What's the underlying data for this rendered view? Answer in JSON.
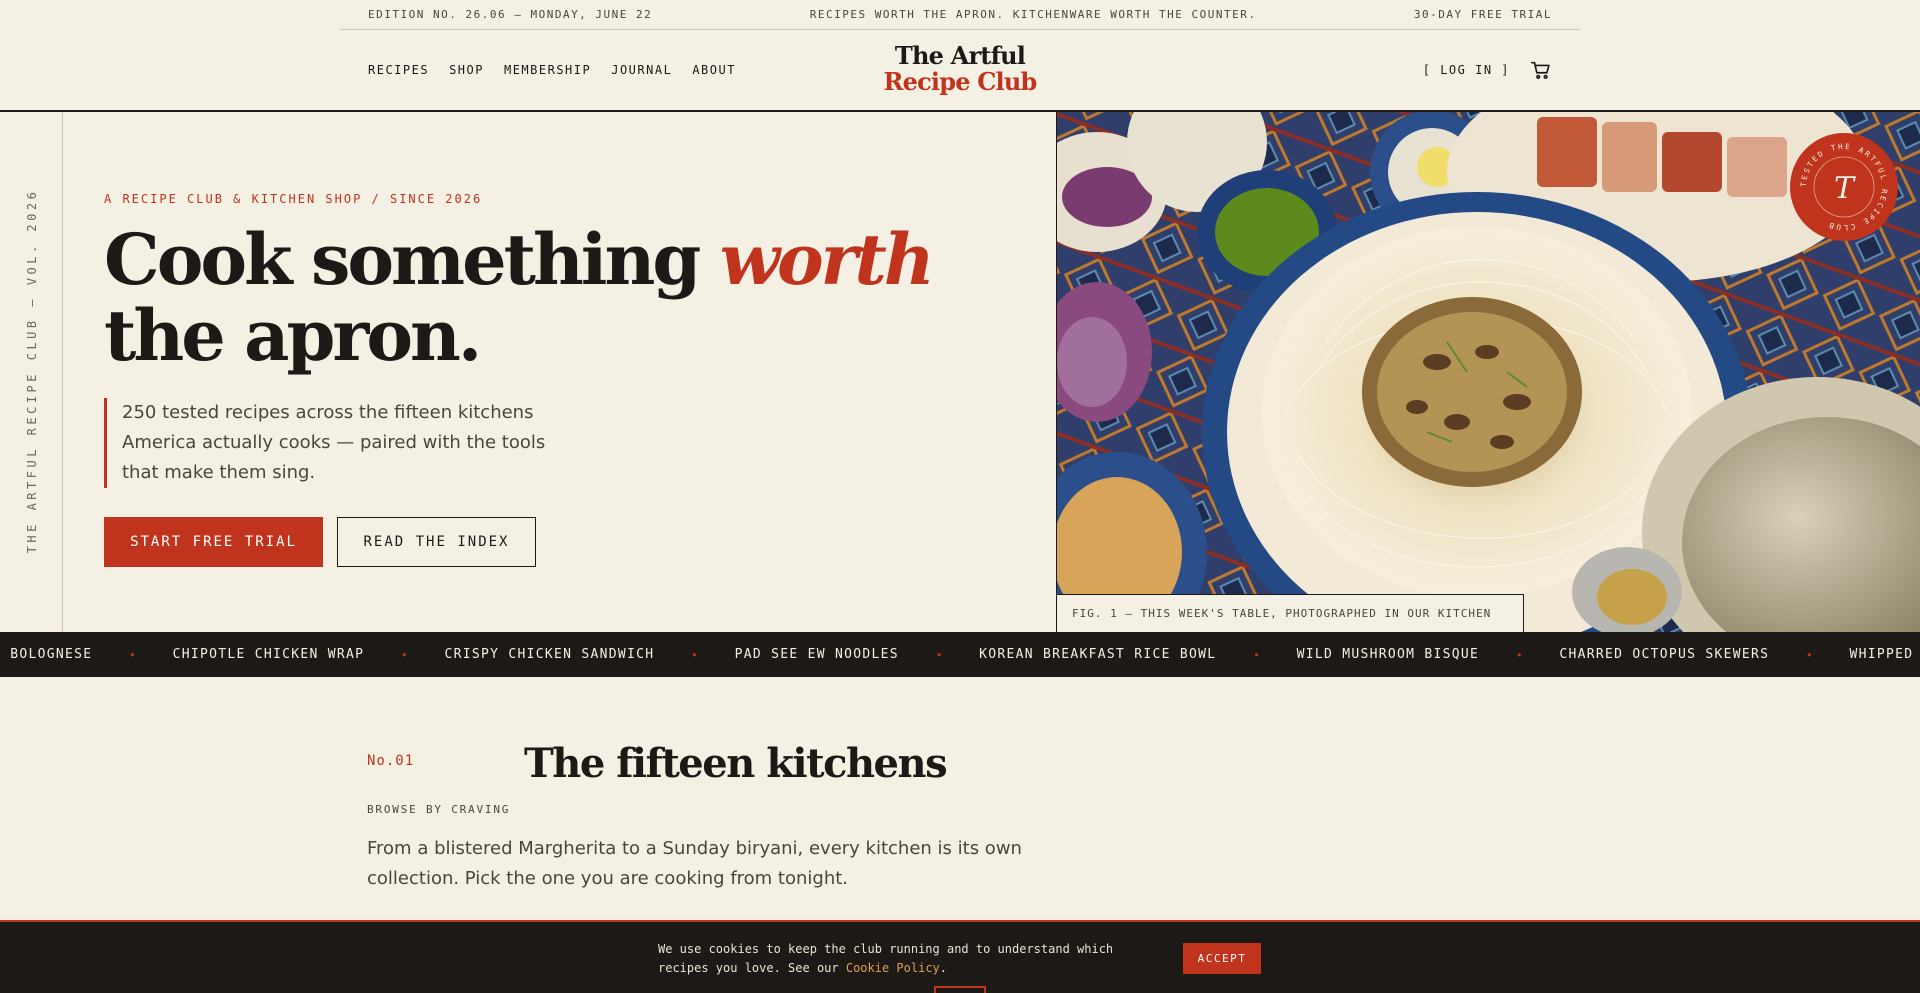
{
  "topbar": {
    "edition": "EDITION NO. 26.06 — MONDAY, JUNE 22",
    "tagline": "RECIPES WORTH THE APRON. KITCHENWARE WORTH THE COUNTER.",
    "trial": "30-DAY FREE TRIAL"
  },
  "nav": {
    "links": [
      "RECIPES",
      "SHOP",
      "MEMBERSHIP",
      "JOURNAL",
      "ABOUT"
    ],
    "logo_line1": "The Artful",
    "logo_line2": "Recipe Club",
    "login": "[ LOG IN ]",
    "cart_icon": "cart-icon"
  },
  "hero": {
    "vertical_label": "THE ARTFUL RECIPE CLUB — VOL. 2026",
    "eyebrow": "A RECIPE CLUB & KITCHEN SHOP / SINCE 2026",
    "title_pre": "Cook something ",
    "title_em": "worth",
    "title_post": " the apron.",
    "description": "250 tested recipes across the fifteen kitchens America actually cooks — paired with the tools that make them sing.",
    "cta_primary": "START FREE TRIAL",
    "cta_secondary": "READ THE INDEX",
    "image_caption": "FIG. 1 — THIS WEEK'S TABLE, PHOTOGRAPHED IN OUR KITCHEN",
    "seal_ring_text": "TESTED THE ARTFUL RECIPE CLUB",
    "seal_letter": "T"
  },
  "ticker": {
    "items": [
      "I BOLOGNESE",
      "CHIPOTLE CHICKEN WRAP",
      "CRISPY CHICKEN SANDWICH",
      "PAD SEE EW NOODLES",
      "KOREAN BREAKFAST RICE BOWL",
      "WILD MUSHROOM BISQUE",
      "CHARRED OCTOPUS SKEWERS",
      "WHIPPED F"
    ],
    "separator": "•"
  },
  "section": {
    "number": "No.01",
    "title": "The fifteen kitchens",
    "subtitle": "BROWSE BY CRAVING",
    "description": "From a blistered Margherita to a Sunday biryani, every kitchen is its own collection. Pick the one you are cooking from tonight."
  },
  "cookie": {
    "text": "We use cookies to keep the club running and to understand which recipes you love. See our ",
    "link": "Cookie Policy",
    "end": ".",
    "button": "ACCEPT"
  },
  "colors": {
    "background": "#f5f0e4",
    "ink": "#1c1916",
    "accent": "#c0341d",
    "link": "#e0a04a"
  }
}
